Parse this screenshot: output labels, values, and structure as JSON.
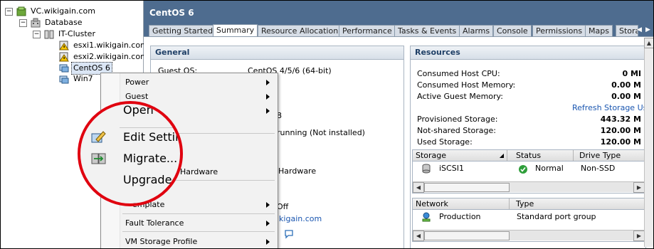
{
  "tree": {
    "vcenter": "VC.wikigain.com",
    "datacenter": "Database",
    "cluster": "IT-Cluster",
    "hosts": [
      "esxi1.wikigain.com",
      "esxi2.wikigain.com"
    ],
    "vms": [
      "CentOS 6",
      "Win7"
    ]
  },
  "header": {
    "title": "CentOS 6"
  },
  "tabs": [
    "Getting Started",
    "Summary",
    "Resource Allocation",
    "Performance",
    "Tasks & Events",
    "Alarms",
    "Console",
    "Permissions",
    "Maps",
    "Stora"
  ],
  "general": {
    "title": "General",
    "guest_os_label": "Guest OS:",
    "guest_os_value": "CentOS 4/5/6 (64-bit)",
    "partial_1": "8",
    "partial_2": "running (Not installed)",
    "partial_hw": "Hardware",
    "partial_off": "Off",
    "partial_link": "ikigain.com"
  },
  "resources": {
    "title": "Resources",
    "rows": [
      {
        "label": "Consumed Host CPU:",
        "value": "0 MI"
      },
      {
        "label": "Consumed Host Memory:",
        "value": "0.00 M"
      },
      {
        "label": "Active Guest Memory:",
        "value": "0.00 M"
      }
    ],
    "refresh": "Refresh Storage Usa",
    "storage_rows": [
      {
        "label": "Provisioned Storage:",
        "value": "443.32 M"
      },
      {
        "label": "Not-shared Storage:",
        "value": "120.00 M"
      },
      {
        "label": "Used Storage:",
        "value": "120.00 M"
      }
    ],
    "storage_table": {
      "headers": [
        "Storage",
        "Status",
        "Drive Type"
      ],
      "rows": [
        {
          "name": "iSCSI1",
          "status": "Normal",
          "drive": "Non-SSD"
        }
      ]
    },
    "network_table": {
      "headers": [
        "Network",
        "Type"
      ],
      "rows": [
        {
          "name": "Production",
          "type": "Standard port group"
        }
      ]
    }
  },
  "context_menu": {
    "items": [
      "Power",
      "Guest",
      "Open",
      "Edit Settings",
      "Migrate...",
      "Upgrade Virtual Hardware",
      "Template",
      "Fault Tolerance",
      "VM Storage Profile"
    ],
    "big_labels": [
      "Open",
      "Edit Setting",
      "Migrate...",
      "Upgrade V"
    ],
    "small_fragments": [
      "Hardware",
      "emplate"
    ]
  },
  "colors": {
    "accent": "#4e6c8f",
    "highlight": "#e0000f"
  }
}
